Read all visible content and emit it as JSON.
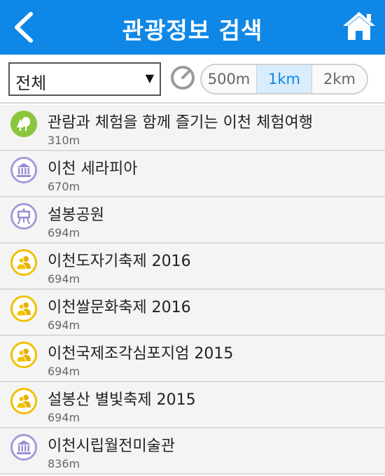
{
  "header": {
    "title": "관광정보 검색",
    "back_icon": "back-chevron-icon",
    "home_icon": "home-icon",
    "color": "#0f87e6"
  },
  "filter": {
    "category": "전체",
    "distance_icon": "gauge-icon",
    "distance_options": [
      "500m",
      "1km",
      "2km"
    ],
    "selected_distance": "1km"
  },
  "results": [
    {
      "title": "관람과 체험을 함께 즐기는 이천 체험여행",
      "distance": "310m",
      "icon": "nature-tree-icon"
    },
    {
      "title": "이천 세라피아",
      "distance": "670m",
      "icon": "museum-icon"
    },
    {
      "title": "설봉공원",
      "distance": "694m",
      "icon": "easel-icon"
    },
    {
      "title": "이천도자기축제 2016",
      "distance": "694m",
      "icon": "festival-people-icon"
    },
    {
      "title": "이천쌀문화축제 2016",
      "distance": "694m",
      "icon": "festival-people-icon"
    },
    {
      "title": "이천국제조각심포지엄 2015",
      "distance": "694m",
      "icon": "festival-people-icon"
    },
    {
      "title": "설봉산 별빛축제 2015",
      "distance": "694m",
      "icon": "festival-people-icon"
    },
    {
      "title": "이천시립월전미술관",
      "distance": "836m",
      "icon": "museum-icon"
    }
  ]
}
